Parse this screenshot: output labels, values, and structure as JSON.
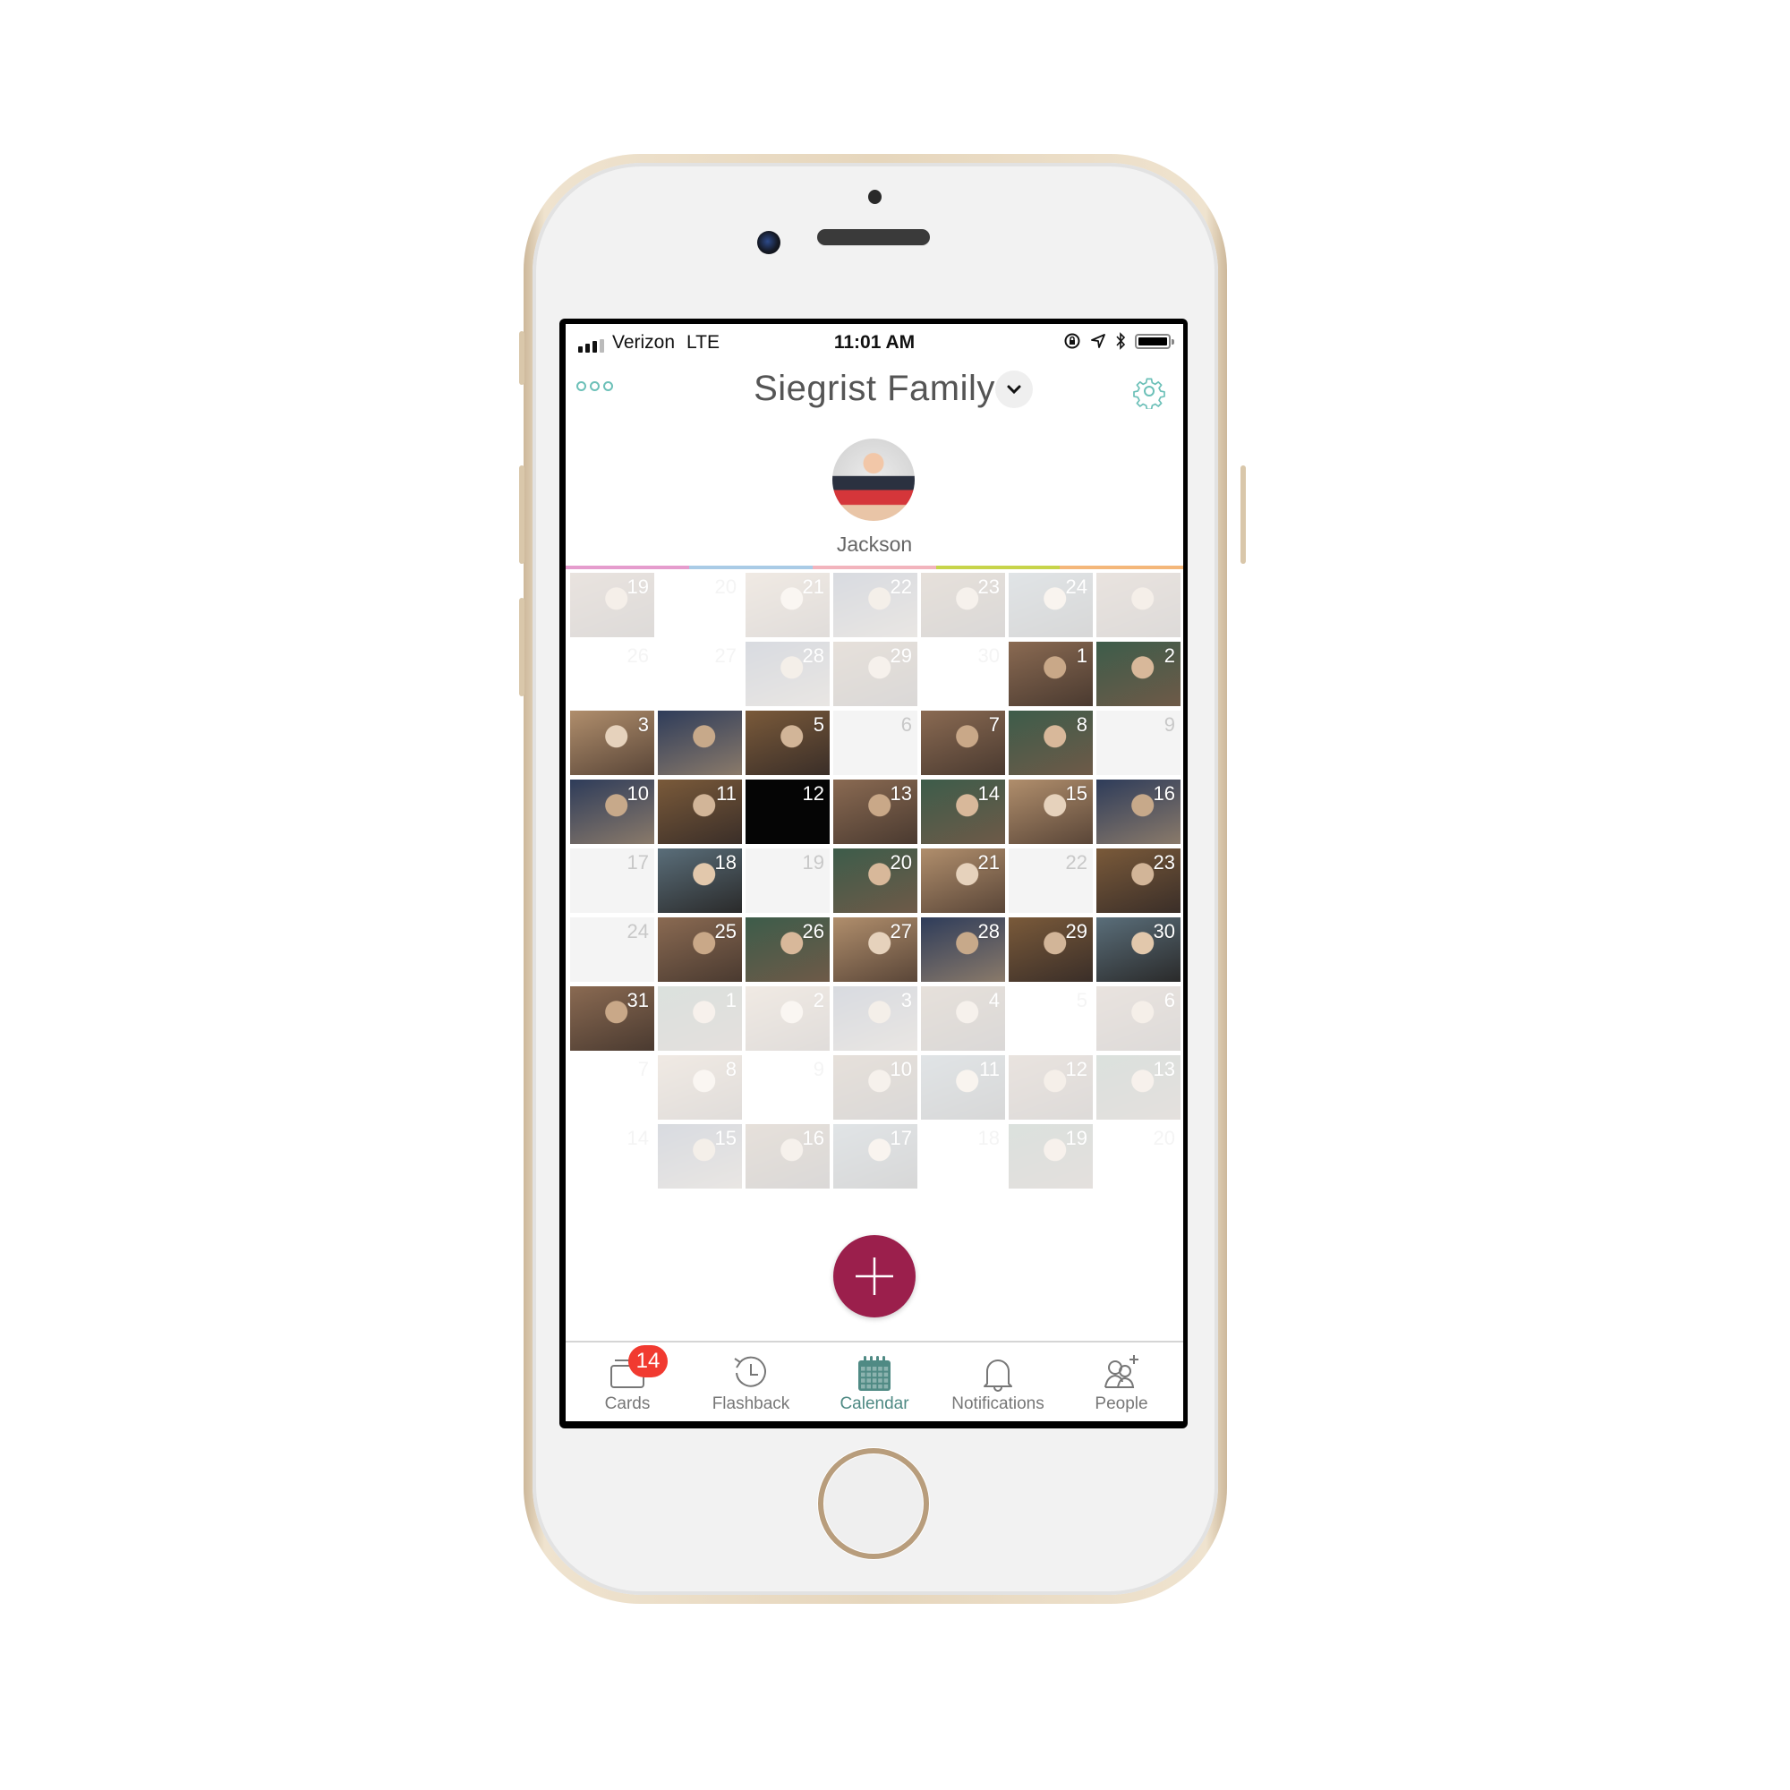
{
  "device": {
    "model": "iphone",
    "color": "gold"
  },
  "status_bar": {
    "carrier": "Verizon",
    "network": "LTE",
    "time": "11:01 AM",
    "icons": [
      "signal-icon",
      "orientation-lock-icon",
      "location-icon",
      "bluetooth-icon",
      "battery-icon"
    ],
    "battery_level": 1.0
  },
  "header": {
    "menu_icon": "more-dots-icon",
    "title": "Siegrist Family",
    "dropdown_icon": "chevron-down-icon",
    "settings_icon": "gear-icon"
  },
  "profile": {
    "name": "Jackson"
  },
  "stripe_colors": [
    "#e59ccd",
    "#a9cbe6",
    "#f2b4bd",
    "#c7d44a",
    "#f4b77a"
  ],
  "accent_color": "#4f8a84",
  "fab_color": "#9b1f4c",
  "calendar": {
    "weeks": [
      [
        {
          "d": "19",
          "s": "faded-photo"
        },
        {
          "d": "20",
          "s": "faded-empty"
        },
        {
          "d": "21",
          "s": "faded-photo"
        },
        {
          "d": "22",
          "s": "faded-photo"
        },
        {
          "d": "23",
          "s": "faded-photo"
        },
        {
          "d": "24",
          "s": "faded-photo"
        },
        {
          "d": "",
          "s": "faded-photo"
        }
      ],
      [
        {
          "d": "26",
          "s": "faded-empty"
        },
        {
          "d": "27",
          "s": "faded-empty"
        },
        {
          "d": "28",
          "s": "faded-photo"
        },
        {
          "d": "29",
          "s": "faded-photo"
        },
        {
          "d": "30",
          "s": "faded-empty"
        },
        {
          "d": "1",
          "s": "photo"
        },
        {
          "d": "2",
          "s": "photo"
        }
      ],
      [
        {
          "d": "3",
          "s": "photo"
        },
        {
          "d": "",
          "s": "photo"
        },
        {
          "d": "5",
          "s": "photo"
        },
        {
          "d": "6",
          "s": "empty"
        },
        {
          "d": "7",
          "s": "photo"
        },
        {
          "d": "8",
          "s": "photo"
        },
        {
          "d": "9",
          "s": "empty"
        }
      ],
      [
        {
          "d": "10",
          "s": "photo"
        },
        {
          "d": "11",
          "s": "photo"
        },
        {
          "d": "12",
          "s": "photo-dark"
        },
        {
          "d": "13",
          "s": "photo"
        },
        {
          "d": "14",
          "s": "photo"
        },
        {
          "d": "15",
          "s": "photo"
        },
        {
          "d": "16",
          "s": "photo"
        }
      ],
      [
        {
          "d": "17",
          "s": "empty"
        },
        {
          "d": "18",
          "s": "photo"
        },
        {
          "d": "19",
          "s": "empty"
        },
        {
          "d": "20",
          "s": "photo"
        },
        {
          "d": "21",
          "s": "photo"
        },
        {
          "d": "22",
          "s": "empty"
        },
        {
          "d": "23",
          "s": "photo"
        }
      ],
      [
        {
          "d": "24",
          "s": "empty"
        },
        {
          "d": "25",
          "s": "photo"
        },
        {
          "d": "26",
          "s": "photo"
        },
        {
          "d": "27",
          "s": "photo"
        },
        {
          "d": "28",
          "s": "photo"
        },
        {
          "d": "29",
          "s": "photo"
        },
        {
          "d": "30",
          "s": "photo"
        }
      ],
      [
        {
          "d": "31",
          "s": "photo"
        },
        {
          "d": "1",
          "s": "faded-photo"
        },
        {
          "d": "2",
          "s": "faded-photo"
        },
        {
          "d": "3",
          "s": "faded-photo"
        },
        {
          "d": "4",
          "s": "faded-photo"
        },
        {
          "d": "5",
          "s": "faded-empty"
        },
        {
          "d": "6",
          "s": "faded-photo"
        }
      ],
      [
        {
          "d": "7",
          "s": "faded-empty"
        },
        {
          "d": "8",
          "s": "faded-photo"
        },
        {
          "d": "9",
          "s": "faded-empty"
        },
        {
          "d": "10",
          "s": "faded-photo"
        },
        {
          "d": "11",
          "s": "faded-photo"
        },
        {
          "d": "12",
          "s": "faded-photo"
        },
        {
          "d": "13",
          "s": "faded-photo"
        }
      ],
      [
        {
          "d": "14",
          "s": "faded-empty"
        },
        {
          "d": "15",
          "s": "faded-photo"
        },
        {
          "d": "16",
          "s": "faded-photo"
        },
        {
          "d": "17",
          "s": "faded-photo"
        },
        {
          "d": "18",
          "s": "faded-empty"
        },
        {
          "d": "19",
          "s": "faded-photo"
        },
        {
          "d": "20",
          "s": "faded-empty"
        }
      ]
    ]
  },
  "fab": {
    "icon": "plus-icon"
  },
  "tabs": [
    {
      "label": "Cards",
      "icon": "cards-icon",
      "badge": "14",
      "active": false
    },
    {
      "label": "Flashback",
      "icon": "history-clock-icon",
      "active": false
    },
    {
      "label": "Calendar",
      "icon": "calendar-icon",
      "active": true
    },
    {
      "label": "Notifications",
      "icon": "bell-icon",
      "active": false
    },
    {
      "label": "People",
      "icon": "add-people-icon",
      "active": false
    }
  ]
}
